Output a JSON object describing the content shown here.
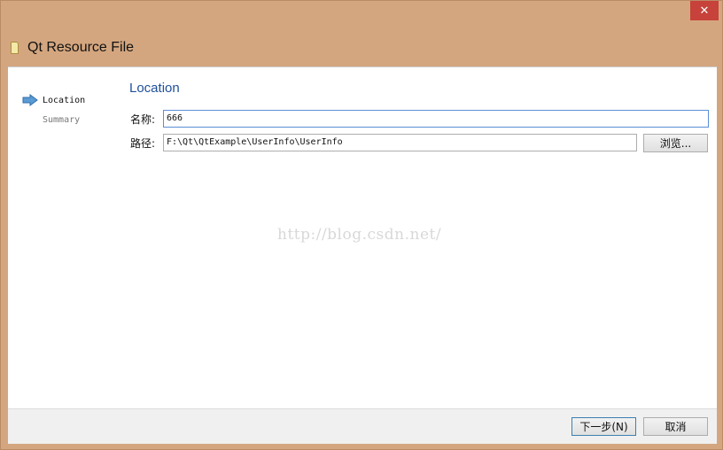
{
  "window": {
    "title": "Qt Resource File",
    "close_glyph": "✕"
  },
  "steps": [
    {
      "label": "Location",
      "active": true
    },
    {
      "label": "Summary",
      "active": false
    }
  ],
  "page": {
    "title": "Location"
  },
  "form": {
    "name_label": "名称:",
    "name_value": "666",
    "path_label": "路径:",
    "path_value": "F:\\Qt\\QtExample\\UserInfo\\UserInfo",
    "browse_label": "浏览..."
  },
  "watermark": "http://blog.csdn.net/",
  "footer": {
    "next_label": "下一步(N)",
    "cancel_label": "取消"
  },
  "colors": {
    "frame": "#d4a67f",
    "title_accent": "#1e4f9a",
    "close_button": "#c7423a",
    "arrow": "#5b9bd5"
  }
}
